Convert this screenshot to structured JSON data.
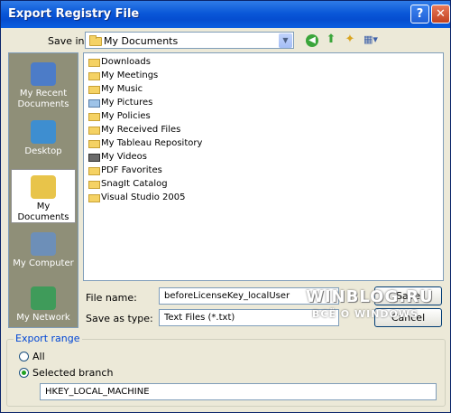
{
  "window": {
    "title": "Export Registry File",
    "help_glyph": "?",
    "close_glyph": "✕"
  },
  "save_in": {
    "label": "Save in:",
    "value": "My Documents"
  },
  "places": [
    {
      "name": "My Recent Documents",
      "line1": "My Recent",
      "line2": "Documents",
      "selected": false,
      "color": "#4c7cc8"
    },
    {
      "name": "Desktop",
      "line1": "Desktop",
      "line2": "",
      "selected": false,
      "color": "#3e8ed0"
    },
    {
      "name": "My Documents",
      "line1": "My Documents",
      "line2": "",
      "selected": true,
      "color": "#e8c44a"
    },
    {
      "name": "My Computer",
      "line1": "My Computer",
      "line2": "",
      "selected": false,
      "color": "#6d8fb8"
    },
    {
      "name": "My Network",
      "line1": "My Network",
      "line2": "",
      "selected": false,
      "color": "#3f9b5a"
    }
  ],
  "files": [
    {
      "name": "Downloads",
      "icon": "folder-icon"
    },
    {
      "name": "My Meetings",
      "icon": "folder-icon"
    },
    {
      "name": "My Music",
      "icon": "music-folder-icon"
    },
    {
      "name": "My Pictures",
      "icon": "pictures-folder-icon"
    },
    {
      "name": "My Policies",
      "icon": "folder-icon"
    },
    {
      "name": "My Received Files",
      "icon": "folder-icon"
    },
    {
      "name": "My Tableau Repository",
      "icon": "folder-icon"
    },
    {
      "name": "My Videos",
      "icon": "videos-folder-icon"
    },
    {
      "name": "PDF Favorites",
      "icon": "folder-icon"
    },
    {
      "name": "SnagIt Catalog",
      "icon": "folder-icon"
    },
    {
      "name": "Visual Studio 2005",
      "icon": "folder-icon"
    }
  ],
  "file_name": {
    "label": "File name:",
    "value": "beforeLicenseKey_localUser"
  },
  "save_as_type": {
    "label": "Save as type:",
    "value": "Text Files (*.txt)"
  },
  "buttons": {
    "save": "Save",
    "cancel": "Cancel"
  },
  "watermark": {
    "line1": "WINBLOG.RU",
    "line2": "ВСЁ О WINDOWS"
  },
  "export_range": {
    "label": "Export range",
    "all_label": "All",
    "selected_label": "Selected branch",
    "branch_value": "HKEY_LOCAL_MACHINE",
    "selected": "Selected branch"
  }
}
